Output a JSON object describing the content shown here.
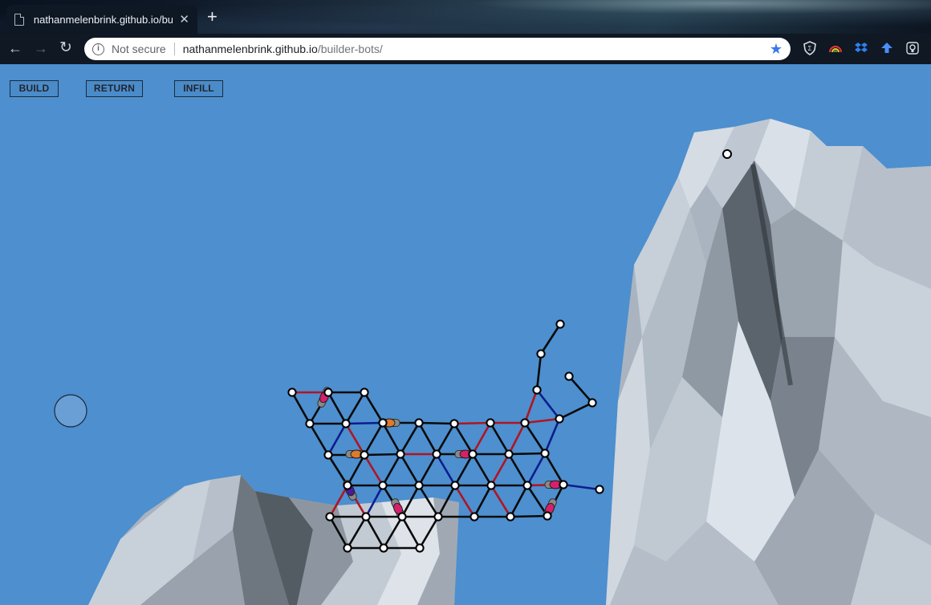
{
  "browser": {
    "tab_title": "nathanmelenbrink.github.io/builder-bots/",
    "close_glyph": "✕",
    "new_tab_glyph": "+",
    "security_label": "Not secure",
    "url_host": "nathanmelenbrink.github.io",
    "url_path": "/builder-bots/",
    "extensions": [
      "shield-extension",
      "rainbow-extension",
      "dropbox-extension",
      "upload-extension",
      "bulb-extension"
    ]
  },
  "game": {
    "buttons": {
      "build": "BUILD",
      "return": "RETURN",
      "infill": "INFILL"
    },
    "colors": {
      "sky": "#4d8fcf",
      "strut": "#0a0a0a",
      "strut_red": "#b01522",
      "strut_blue": "#0c1d8e",
      "node_fill": "#ffffff",
      "bot_pink": "#d6206a",
      "bot_orange": "#de7a2c",
      "bot_purple": "#4a1a9a",
      "bot_body": "#8a8a8a"
    }
  }
}
